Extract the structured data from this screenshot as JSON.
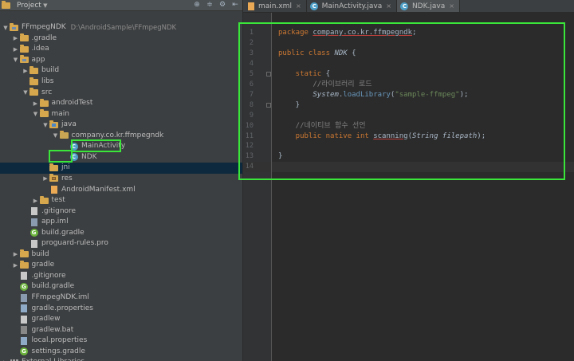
{
  "project_panel": {
    "title": "Project",
    "tools": [
      "⊕",
      "≑",
      "⚙",
      "⇤"
    ],
    "tree": [
      {
        "label": "FFmpegNDK",
        "hint": "D:\\AndroidSample\\FFmpegNDK",
        "indent": 0,
        "arrow": "▼",
        "icon": "folder-mod"
      },
      {
        "label": ".gradle",
        "indent": 1,
        "arrow": "▶",
        "icon": "folder"
      },
      {
        "label": ".idea",
        "indent": 1,
        "arrow": "▶",
        "icon": "folder"
      },
      {
        "label": "app",
        "indent": 1,
        "arrow": "▼",
        "icon": "folder-mod"
      },
      {
        "label": "build",
        "indent": 2,
        "arrow": "▶",
        "icon": "folder"
      },
      {
        "label": "libs",
        "indent": 2,
        "arrow": "",
        "icon": "folder"
      },
      {
        "label": "src",
        "indent": 2,
        "arrow": "▼",
        "icon": "folder"
      },
      {
        "label": "androidTest",
        "indent": 3,
        "arrow": "▶",
        "icon": "folder"
      },
      {
        "label": "main",
        "indent": 3,
        "arrow": "▼",
        "icon": "folder"
      },
      {
        "label": "java",
        "indent": 4,
        "arrow": "▼",
        "icon": "folder-src"
      },
      {
        "label": "company.co.kr.ffmpegndk",
        "indent": 5,
        "arrow": "▼",
        "icon": "package"
      },
      {
        "label": "MainActivity",
        "indent": 6,
        "arrow": "",
        "icon": "class"
      },
      {
        "label": "NDK",
        "indent": 6,
        "arrow": "",
        "icon": "class"
      },
      {
        "label": "jni",
        "indent": 4,
        "arrow": "",
        "icon": "folder",
        "selected": true
      },
      {
        "label": "res",
        "indent": 4,
        "arrow": "▶",
        "icon": "folder-res"
      },
      {
        "label": "AndroidManifest.xml",
        "indent": 4,
        "arrow": "",
        "icon": "xml"
      },
      {
        "label": "test",
        "indent": 3,
        "arrow": "▶",
        "icon": "folder"
      },
      {
        "label": ".gitignore",
        "indent": 2,
        "arrow": "",
        "icon": "file"
      },
      {
        "label": "app.iml",
        "indent": 2,
        "arrow": "",
        "icon": "iml"
      },
      {
        "label": "build.gradle",
        "indent": 2,
        "arrow": "",
        "icon": "gradle"
      },
      {
        "label": "proguard-rules.pro",
        "indent": 2,
        "arrow": "",
        "icon": "file"
      },
      {
        "label": "build",
        "indent": 1,
        "arrow": "▶",
        "icon": "folder"
      },
      {
        "label": "gradle",
        "indent": 1,
        "arrow": "▶",
        "icon": "folder"
      },
      {
        "label": ".gitignore",
        "indent": 1,
        "arrow": "",
        "icon": "file"
      },
      {
        "label": "build.gradle",
        "indent": 1,
        "arrow": "",
        "icon": "gradle"
      },
      {
        "label": "FFmpegNDK.iml",
        "indent": 1,
        "arrow": "",
        "icon": "iml"
      },
      {
        "label": "gradle.properties",
        "indent": 1,
        "arrow": "",
        "icon": "props"
      },
      {
        "label": "gradlew",
        "indent": 1,
        "arrow": "",
        "icon": "file"
      },
      {
        "label": "gradlew.bat",
        "indent": 1,
        "arrow": "",
        "icon": "bat"
      },
      {
        "label": "local.properties",
        "indent": 1,
        "arrow": "",
        "icon": "props"
      },
      {
        "label": "settings.gradle",
        "indent": 1,
        "arrow": "",
        "icon": "gradle"
      },
      {
        "label": "External Libraries",
        "indent": 0,
        "arrow": "▶",
        "icon": "libraries"
      }
    ]
  },
  "editor": {
    "tabs": [
      {
        "label": "main.xml",
        "icon": "xml",
        "active": false
      },
      {
        "label": "MainActivity.java",
        "icon": "class",
        "active": false
      },
      {
        "label": "NDK.java",
        "icon": "class",
        "active": true
      }
    ],
    "close_glyph": "×",
    "lines": [
      {
        "n": "1",
        "seg": [
          {
            "t": "package ",
            "c": "kw"
          },
          {
            "t": "company.co.kr.ffmpegndk",
            "c": "ulined"
          },
          {
            "t": ";",
            "c": ""
          }
        ]
      },
      {
        "n": "2",
        "seg": []
      },
      {
        "n": "3",
        "seg": [
          {
            "t": "public class ",
            "c": "kw"
          },
          {
            "t": "NDK",
            "c": "cls-it"
          },
          {
            "t": " {",
            "c": ""
          }
        ]
      },
      {
        "n": "4",
        "seg": []
      },
      {
        "n": "5",
        "seg": [
          {
            "t": "    static ",
            "c": "kw"
          },
          {
            "t": "{",
            "c": ""
          }
        ]
      },
      {
        "n": "6",
        "seg": [
          {
            "t": "        //라이브러리 로드",
            "c": "cm"
          }
        ]
      },
      {
        "n": "7",
        "seg": [
          {
            "t": "        ",
            "c": ""
          },
          {
            "t": "System",
            "c": "cls-it"
          },
          {
            "t": ".",
            "c": ""
          },
          {
            "t": "loadLibrary",
            "c": "lib"
          },
          {
            "t": "(",
            "c": ""
          },
          {
            "t": "\"sample-ffmpeg\"",
            "c": "str"
          },
          {
            "t": ");",
            "c": ""
          }
        ]
      },
      {
        "n": "8",
        "seg": [
          {
            "t": "    }",
            "c": ""
          }
        ]
      },
      {
        "n": "9",
        "seg": []
      },
      {
        "n": "10",
        "seg": [
          {
            "t": "    //네이티브 함수 선언",
            "c": "cm"
          }
        ]
      },
      {
        "n": "11",
        "seg": [
          {
            "t": "    public native int ",
            "c": "kw"
          },
          {
            "t": "scanning",
            "c": "ulined"
          },
          {
            "t": "(",
            "c": ""
          },
          {
            "t": "String filepath",
            "c": "cls-it"
          },
          {
            "t": ");",
            "c": ""
          }
        ]
      },
      {
        "n": "12",
        "seg": []
      },
      {
        "n": "13",
        "seg": [
          {
            "t": "}",
            "c": ""
          }
        ]
      },
      {
        "n": "14",
        "seg": []
      }
    ],
    "current_line": "14"
  },
  "colors": {
    "highlight_box": "#39e639",
    "keyword": "#cc7832",
    "comment": "#808080",
    "string": "#6a8759"
  }
}
